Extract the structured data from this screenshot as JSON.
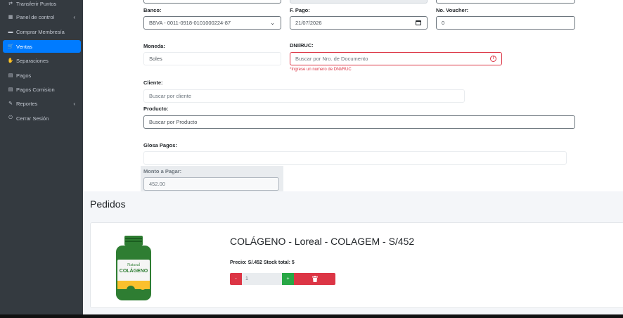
{
  "sidebar": {
    "items": [
      {
        "label": "Transferir Puntos",
        "icon": "transfer-icon",
        "glyph": "⇄"
      },
      {
        "label": "Panel de control",
        "icon": "dashboard-icon",
        "glyph": "▦",
        "chevron": "‹"
      },
      {
        "label": "Comprar Membresía",
        "icon": "membership-card-icon",
        "glyph": "▬"
      },
      {
        "label": "Ventas",
        "icon": "cart-icon",
        "glyph": "🛒"
      },
      {
        "label": "Separaciones",
        "icon": "handshake-icon",
        "glyph": "✋"
      },
      {
        "label": "Pagos",
        "icon": "money-icon",
        "glyph": "▤"
      },
      {
        "label": "Pagos Comision",
        "icon": "money-icon",
        "glyph": "▤"
      },
      {
        "label": "Reportes",
        "icon": "report-icon",
        "glyph": "✎",
        "chevron": "‹"
      },
      {
        "label": "Cerrar Sesión",
        "icon": "power-icon",
        "glyph": "⏻"
      }
    ]
  },
  "form": {
    "banco": {
      "label": "Banco:",
      "value": "BBVA - 0011-0918-0101000224-87",
      "arrow": "⌄"
    },
    "fpago": {
      "label": "F. Pago:",
      "value": "21/07/2026"
    },
    "voucher": {
      "label": "No. Voucher:",
      "value": "0"
    },
    "moneda": {
      "label": "Moneda:",
      "value": "Soles"
    },
    "dni": {
      "label": "DNI/RUC:",
      "placeholder": "Buscar por Nro. de Documento",
      "error": "*Ingrese un numero de DNI/RUC",
      "error_glyph": "!"
    },
    "cliente": {
      "label": "Cliente:",
      "placeholder": "Buscar por cliente"
    },
    "producto": {
      "label": "Producto:",
      "placeholder": "Buscar por Producto"
    },
    "glosa": {
      "label": "Glosa Pagos:",
      "value": ""
    },
    "monto": {
      "label": "Monto a Pagar:",
      "value": "452.00"
    }
  },
  "pedidos": {
    "title": "Pedidos",
    "product": {
      "name": "COLÁGENO - Loreal - COLAGEM - S/452",
      "meta": "Precio: S/.452   Stock total: 5",
      "quantity": "1",
      "minus": "-",
      "plus": "+",
      "image_text": {
        "brand": "Natural",
        "name": "COLÁGENO"
      }
    }
  },
  "colors": {
    "sidebar_bg": "#343a40",
    "active": "#007bff",
    "danger": "#dc3545",
    "success": "#28a745"
  }
}
